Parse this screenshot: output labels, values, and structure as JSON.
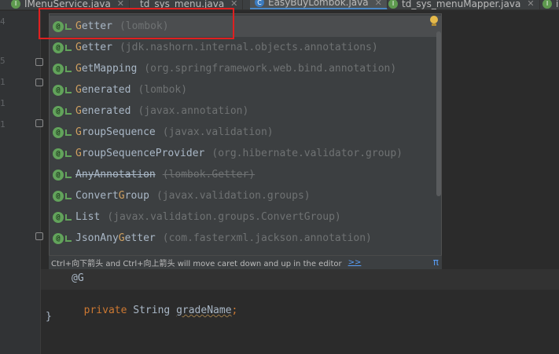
{
  "tabs": [
    {
      "label": "IMenuService.java",
      "icon": "I",
      "kind": "interface",
      "active": false
    },
    {
      "label": "td_sys_menu.java",
      "icon": "",
      "kind": "file",
      "active": false
    },
    {
      "label": "EasyBuyLombok.java",
      "icon": "C",
      "kind": "class",
      "active": true
    },
    {
      "label": "td_sys_menuMapper.java",
      "icon": "I",
      "kind": "interface",
      "active": false
    },
    {
      "label": "ir",
      "icon": "I",
      "kind": "interface",
      "active": false
    }
  ],
  "completion": {
    "items": [
      {
        "hl": "G",
        "rest": "etter",
        "pkg": "(lombok)",
        "deprecated": false
      },
      {
        "hl": "G",
        "rest": "etter",
        "pkg": "(jdk.nashorn.internal.objects.annotations)",
        "deprecated": false
      },
      {
        "hl": "G",
        "rest": "etMapping",
        "pkg": "(org.springframework.web.bind.annotation)",
        "deprecated": false
      },
      {
        "hl": "G",
        "rest": "enerated",
        "pkg": "(lombok)",
        "deprecated": false
      },
      {
        "hl": "G",
        "rest": "enerated",
        "pkg": "(javax.annotation)",
        "deprecated": false
      },
      {
        "hl": "G",
        "rest": "roupSequence",
        "pkg": "(javax.validation)",
        "deprecated": false
      },
      {
        "hl": "G",
        "rest": "roupSequenceProvider",
        "pkg": "(org.hibernate.validator.group)",
        "deprecated": false
      },
      {
        "pre": "AnyAnnotation",
        "hl": "",
        "rest": "",
        "pkg": "(lombok.Getter)",
        "deprecated": true
      },
      {
        "pre": "Convert",
        "hl": "G",
        "rest": "roup",
        "pkg": "(javax.validation.groups)",
        "deprecated": false
      },
      {
        "pre": "List",
        "hl": "",
        "rest": "",
        "pkg": "(javax.validation.groups.ConvertGroup)",
        "deprecated": false
      },
      {
        "pre": "JsonAny",
        "hl": "G",
        "rest": "etter",
        "pkg": "(com.fasterxml.jackson.annotation)",
        "deprecated": false
      }
    ],
    "hint_text": "Ctrl+向下箭头 and Ctrl+向上箭头 will move caret down and up in the editor",
    "hint_link": ">>",
    "hint_pi": "π"
  },
  "code": {
    "line_annotation": "@G",
    "kw_private": "private",
    "type": "String",
    "field": "gradeName",
    "semicolon": ";",
    "brace": "}"
  },
  "gutter_numbers": [
    "4",
    "5",
    "1",
    "1",
    "1"
  ],
  "colors": {
    "highlight_box": "#e02020",
    "annotation_icon": "#62a35b",
    "keyword": "#cc7832"
  }
}
